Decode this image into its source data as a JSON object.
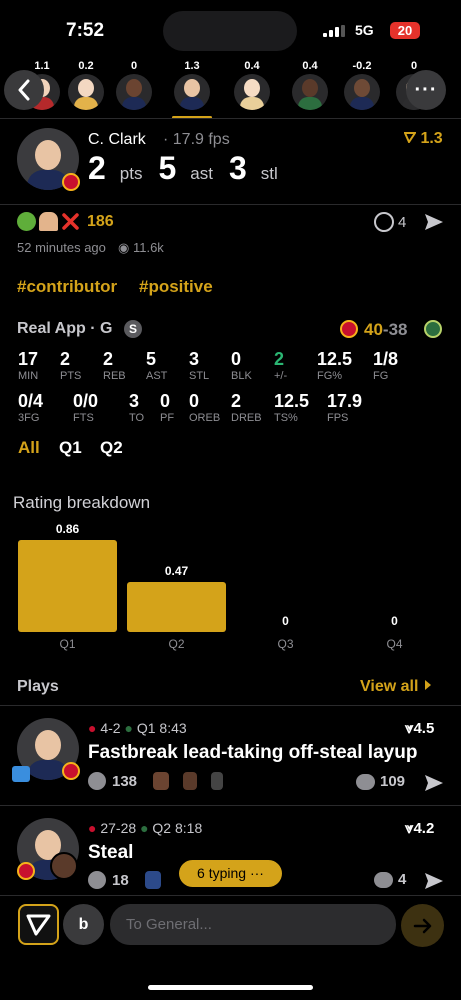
{
  "status_bar": {
    "time": "7:52",
    "network": "5G",
    "battery": "20"
  },
  "player_strip": [
    {
      "value": "1.1",
      "skin": "#f1d3bb",
      "jersey": "#b5292b"
    },
    {
      "value": "0.2",
      "skin": "#f3d8c2",
      "jersey": "#e3b24a"
    },
    {
      "value": "0",
      "skin": "#6b4431",
      "jersey": "#1d2a55"
    },
    {
      "value": "1.3",
      "skin": "#e8c4a4",
      "jersey": "#1d2a55"
    },
    {
      "value": "0.4",
      "skin": "#f6dcc4",
      "jersey": "#e9cf9a"
    },
    {
      "value": "0.4",
      "skin": "#5a3a2a",
      "jersey": "#2c6e3f"
    },
    {
      "value": "-0.2",
      "skin": "#6e4a36",
      "jersey": "#1d2a55"
    },
    {
      "value": "0",
      "skin": "#e2c2a6",
      "jersey": "#2c2c2e"
    }
  ],
  "header": {
    "name": "C. Clark",
    "fps": "· 17.9 fps",
    "rating": "1.3",
    "stats": [
      {
        "num": "2",
        "unit": "pts"
      },
      {
        "num": "5",
        "unit": "ast"
      },
      {
        "num": "3",
        "unit": "stl"
      }
    ]
  },
  "reactions": {
    "count": "186",
    "reposts": "4",
    "time_ago": "52 minutes ago",
    "views": "11.6k"
  },
  "tags": [
    "#contributor",
    "#positive"
  ],
  "game": {
    "source": "Real App · G",
    "badge": "S",
    "score_home": "40",
    "score_sep": "-",
    "score_away": "38",
    "row1": [
      {
        "v": "17",
        "l": "MIN"
      },
      {
        "v": "2",
        "l": "PTS"
      },
      {
        "v": "2",
        "l": "REB"
      },
      {
        "v": "5",
        "l": "AST"
      },
      {
        "v": "3",
        "l": "STL"
      },
      {
        "v": "0",
        "l": "BLK"
      },
      {
        "v": "2",
        "l": "+/-"
      },
      {
        "v": "12.5",
        "l": "FG%"
      },
      {
        "v": "1/8",
        "l": "FG"
      }
    ],
    "row2": [
      {
        "v": "0/4",
        "l": "3FG"
      },
      {
        "v": "0/0",
        "l": "FTS"
      },
      {
        "v": "3",
        "l": "TO"
      },
      {
        "v": "0",
        "l": "PF"
      },
      {
        "v": "0",
        "l": "OREB"
      },
      {
        "v": "2",
        "l": "DREB"
      },
      {
        "v": "12.5",
        "l": "TS%"
      },
      {
        "v": "17.9",
        "l": "FPS"
      }
    ],
    "periods": [
      "All",
      "Q1",
      "Q2"
    ]
  },
  "chart_data": {
    "type": "bar",
    "title": "Rating breakdown",
    "categories": [
      "Q1",
      "Q2",
      "Q3",
      "Q4"
    ],
    "values": [
      0.86,
      0.47,
      0,
      0
    ],
    "value_labels": [
      "0.86",
      "0.47",
      "0",
      "0"
    ],
    "ylim": [
      0,
      0.86
    ],
    "grid": false,
    "color": "#d4a31a"
  },
  "plays": {
    "title": "Plays",
    "view_all": "View all",
    "items": [
      {
        "score": "4-2",
        "time": "Q1 8:43",
        "rating": "4.5",
        "title": "Fastbreak lead-taking off-steal layup",
        "reactions": "138",
        "comments": "109"
      },
      {
        "score": "27-28",
        "time": "Q2 8:18",
        "rating": "4.2",
        "title": "Steal",
        "reactions": "18",
        "comments": "4"
      }
    ],
    "typing": "6 typing ···"
  },
  "composer": {
    "user_initial": "b",
    "placeholder": "To General..."
  },
  "colors": {
    "accent": "#d4a31a",
    "positive": "#2bb673",
    "background": "#000000",
    "danger": "#e5322b"
  }
}
